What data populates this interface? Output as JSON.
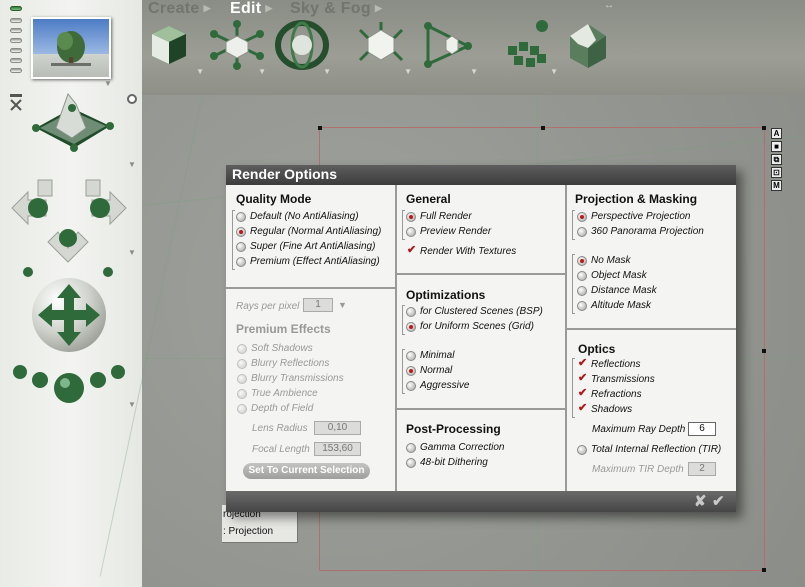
{
  "toolbar": {
    "tabs": [
      {
        "label": "Create"
      },
      {
        "label": "Edit"
      },
      {
        "label": "Sky & Fog"
      }
    ],
    "tools": [
      "cube-icon",
      "transform-icon",
      "torus-icon",
      "deform-icon",
      "path-icon",
      "array-icon",
      "terrain-icon"
    ],
    "resize_glyph": "↔"
  },
  "behind_panel": {
    "line1": "rojection",
    "line2": ": Projection"
  },
  "side_icons": [
    "A",
    "■",
    "⧉",
    "⊡",
    "M"
  ],
  "dialog": {
    "title": "Render Options",
    "quality": {
      "title": "Quality Mode",
      "options": [
        {
          "label": "Default (No AntiAliasing)",
          "selected": false
        },
        {
          "label": "Regular (Normal AntiAliasing)",
          "selected": true
        },
        {
          "label": "Super (Fine Art AntiAliasing)",
          "selected": false
        },
        {
          "label": "Premium (Effect AntiAliasing)",
          "selected": false
        }
      ],
      "rays_label": "Rays per pixel",
      "rays_value": "1",
      "premium_title": "Premium Effects",
      "premium_effects": [
        "Soft Shadows",
        "Blurry Reflections",
        "Blurry Transmissions",
        "True Ambience",
        "Depth of Field"
      ],
      "lens_radius_label": "Lens Radius",
      "lens_radius_value": "0,10",
      "focal_length_label": "Focal Length",
      "focal_length_value": "153,60",
      "set_selection_label": "Set To Current Selection"
    },
    "general": {
      "title": "General",
      "options": [
        {
          "label": "Full Render",
          "selected": true
        },
        {
          "label": "Preview Render",
          "selected": false
        }
      ],
      "textures_label": "Render With Textures",
      "textures_checked": true
    },
    "optimizations": {
      "title": "Optimizations",
      "scene_options": [
        {
          "label": "for Clustered Scenes (BSP)",
          "selected": false
        },
        {
          "label": "for Uniform Scenes (Grid)",
          "selected": true
        }
      ],
      "level_options": [
        {
          "label": "Minimal",
          "selected": false
        },
        {
          "label": "Normal",
          "selected": true
        },
        {
          "label": "Aggressive",
          "selected": false
        }
      ]
    },
    "post": {
      "title": "Post-Processing",
      "options": [
        {
          "label": "Gamma Correction",
          "selected": false
        },
        {
          "label": "48-bit Dithering",
          "selected": false
        }
      ]
    },
    "projection": {
      "title": "Projection & Masking",
      "projection_options": [
        {
          "label": "Perspective Projection",
          "selected": true
        },
        {
          "label": "360  Panorama Projection",
          "selected": false
        }
      ],
      "mask_options": [
        {
          "label": "No Mask",
          "selected": true
        },
        {
          "label": "Object Mask",
          "selected": false
        },
        {
          "label": "Distance Mask",
          "selected": false
        },
        {
          "label": "Altitude Mask",
          "selected": false
        }
      ]
    },
    "optics": {
      "title": "Optics",
      "checks": [
        {
          "label": "Reflections",
          "checked": true
        },
        {
          "label": "Transmissions",
          "checked": true
        },
        {
          "label": "Refractions",
          "checked": true
        },
        {
          "label": "Shadows",
          "checked": true
        }
      ],
      "ray_depth_label": "Maximum Ray Depth",
      "ray_depth_value": "6",
      "tir_label": "Total Internal Reflection (TIR)",
      "tir_depth_label": "Maximum TIR Depth",
      "tir_depth_value": "2"
    },
    "footer": {
      "cancel": "✘",
      "ok": "✔"
    }
  },
  "colors": {
    "accent_red": "#c01818",
    "title_bar": "#4a4a4a",
    "object_green": "#2f6b3a"
  }
}
